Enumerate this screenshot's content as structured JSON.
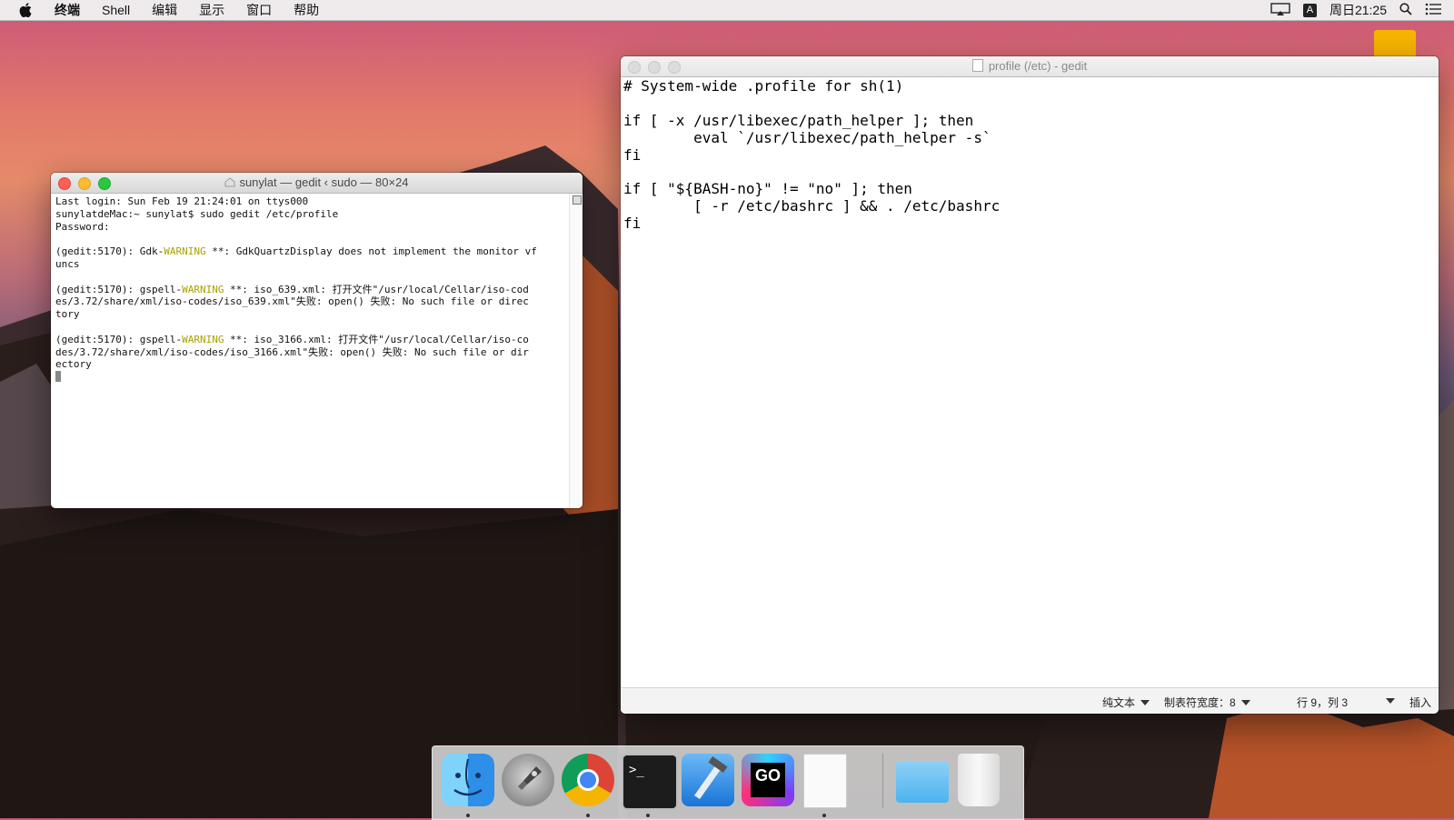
{
  "menubar": {
    "items": [
      "终端",
      "Shell",
      "编辑",
      "显示",
      "窗口",
      "帮助"
    ],
    "ime_label": "A",
    "clock": "周日21:25"
  },
  "terminal": {
    "title": "sunylat — gedit ‹ sudo — 80×24",
    "lines": [
      "Last login: Sun Feb 19 21:24:01 on ttys000",
      "sunylatdeMac:~ sunylat$ sudo gedit /etc/profile",
      "Password:",
      "",
      "(gedit:5170): Gdk-|WARNING| **: GdkQuartzDisplay does not implement the monitor vf",
      "uncs",
      "",
      "(gedit:5170): gspell-|WARNING| **: iso_639.xml: 打开文件\"/usr/local/Cellar/iso-cod",
      "es/3.72/share/xml/iso-codes/iso_639.xml\"失败: open() 失败: No such file or direc",
      "tory",
      "",
      "(gedit:5170): gspell-|WARNING| **: iso_3166.xml: 打开文件\"/usr/local/Cellar/iso-co",
      "des/3.72/share/xml/iso-codes/iso_3166.xml\"失败: open() 失败: No such file or dir",
      "ectory"
    ]
  },
  "gedit": {
    "title": "profile (/etc) - gedit",
    "content": "# System-wide .profile for sh(1)\n\nif [ -x /usr/libexec/path_helper ]; then\n        eval `/usr/libexec/path_helper -s`\nfi\n\nif [ \"${BASH-no}\" != \"no\" ]; then\n        [ -r /etc/bashrc ] && . /etc/bashrc\nfi",
    "status": {
      "language": "纯文本",
      "tab_width": "制表符宽度：8",
      "position": "行 9，列 3",
      "mode": "插入"
    }
  },
  "dock": {
    "apps": [
      {
        "name": "finder",
        "running": true
      },
      {
        "name": "launchpad",
        "running": false
      },
      {
        "name": "chrome",
        "running": true
      },
      {
        "name": "terminal",
        "running": true
      },
      {
        "name": "xcode",
        "running": false
      },
      {
        "name": "gogland",
        "running": false
      },
      {
        "name": "gedit-document",
        "running": true
      },
      {
        "name": "folder",
        "running": false
      },
      {
        "name": "trash",
        "running": false
      }
    ],
    "go_label": "GO"
  }
}
